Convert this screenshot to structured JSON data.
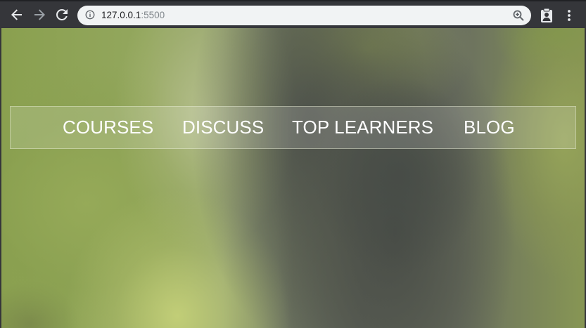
{
  "browser": {
    "url_host": "127.0.0.1",
    "url_port": ":5500",
    "icons": {
      "back": "arrow-left-icon",
      "forward": "arrow-right-icon",
      "reload": "reload-icon",
      "site_info": "info-icon",
      "zoom": "zoom-icon",
      "extension": "clipboard-person-icon",
      "menu": "three-dots-menu-icon"
    }
  },
  "page": {
    "nav_items": [
      {
        "label": "COURSES"
      },
      {
        "label": "DISCUSS"
      },
      {
        "label": "TOP LEARNERS"
      },
      {
        "label": "BLOG"
      }
    ]
  },
  "colors": {
    "toolbar": "#35363a",
    "omnibox": "#f1f3f4",
    "nav_text": "#ffffff"
  }
}
